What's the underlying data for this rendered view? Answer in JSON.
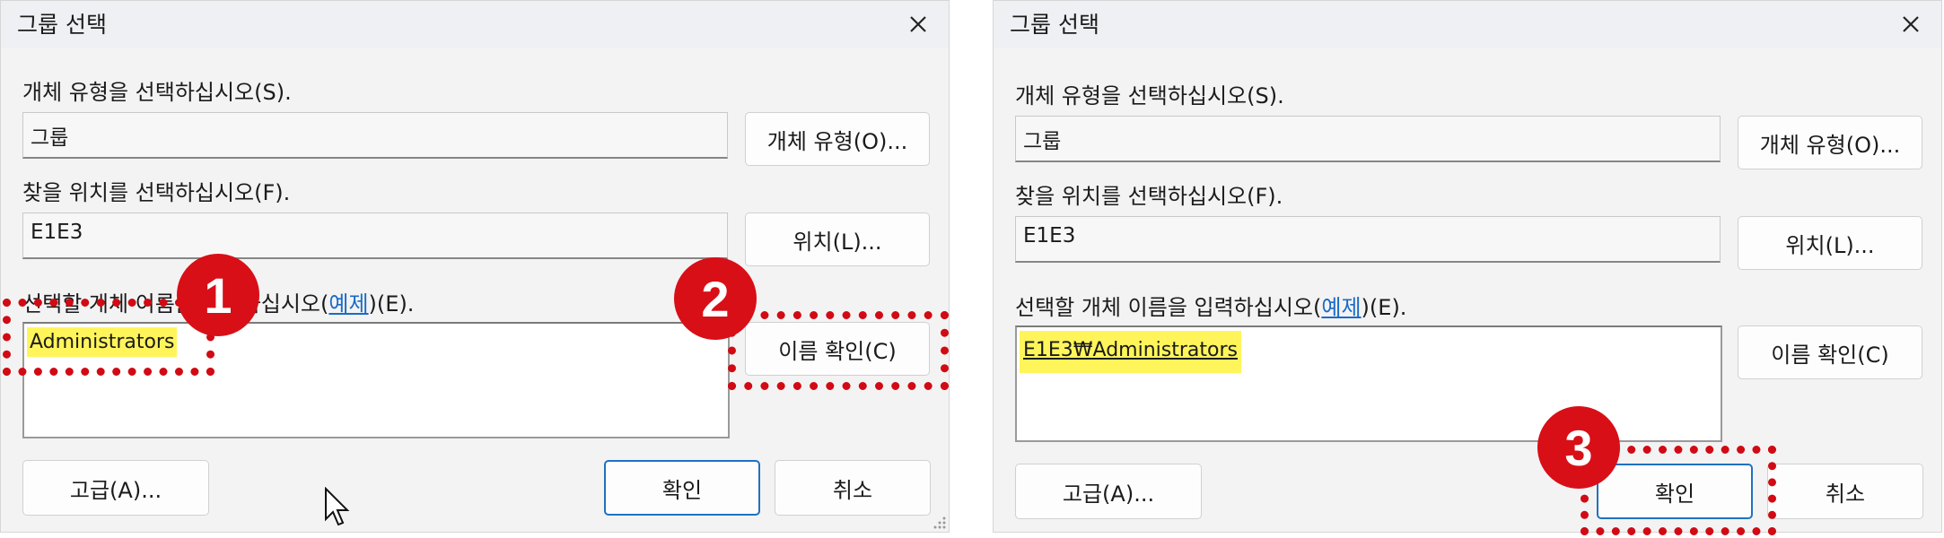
{
  "left": {
    "title": "그룹 선택",
    "object_type_label": "개체 유형을 선택하십시오(S).",
    "object_type_value": "그룹",
    "object_types_button": "개체 유형(O)...",
    "location_label": "찾을 위치를 선택하십시오(F).",
    "location_value": "E1E3",
    "locations_button": "위치(L)...",
    "names_label_pre": "선택할 개체 이름을 입력하십시오(",
    "names_label_link": "예제",
    "names_label_post": ")(E).",
    "names_value": "Administrators",
    "check_names_button": "이름 확인(C)",
    "advanced_button": "고급(A)...",
    "ok_button": "확인",
    "cancel_button": "취소",
    "badge_1": "1",
    "badge_2": "2"
  },
  "right": {
    "title": "그룹 선택",
    "object_type_label": "개체 유형을 선택하십시오(S).",
    "object_type_value": "그룹",
    "object_types_button": "개체 유형(O)...",
    "location_label": "찾을 위치를 선택하십시오(F).",
    "location_value": "E1E3",
    "locations_button": "위치(L)...",
    "names_label_pre": "선택할 개체 이름을 입력하십시오(",
    "names_label_link": "예제",
    "names_label_post": ")(E).",
    "names_value": "E1E3₩Administrators",
    "check_names_button": "이름 확인(C)",
    "advanced_button": "고급(A)...",
    "ok_button": "확인",
    "cancel_button": "취소",
    "badge_3": "3"
  },
  "colors": {
    "annotation_red": "#d10a13",
    "highlight_yellow": "#fff55a",
    "link_blue": "#1a6bc6",
    "default_button_border": "#1f72c0"
  },
  "icons": [
    "close-icon",
    "mouse-cursor-icon",
    "resize-grip-icon"
  ]
}
